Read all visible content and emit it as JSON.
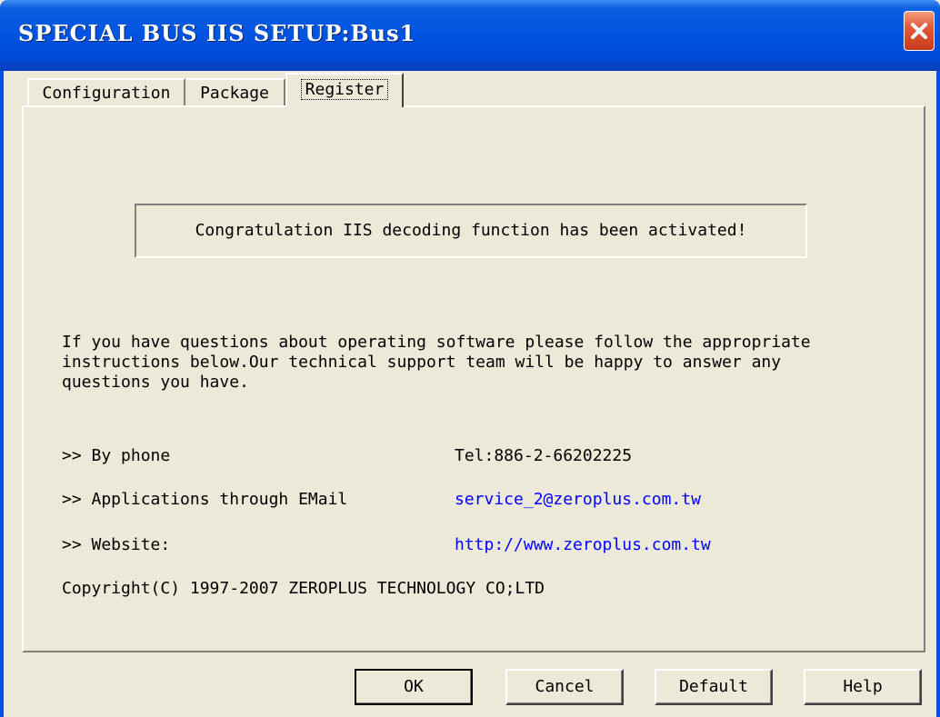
{
  "window": {
    "title": "SPECIAL BUS IIS SETUP:Bus1"
  },
  "tabs": {
    "configuration": "Configuration",
    "package": "Package",
    "register": "Register"
  },
  "register": {
    "notice": "Congratulation IIS decoding function has been activated!",
    "info": "If you have questions about operating software please follow the appropriate\ninstructions below.Our technical support team will be happy to answer any\nquestions you have.",
    "phone_label": ">> By phone",
    "phone_value": "Tel:886-2-66202225",
    "email_label": ">> Applications through EMail",
    "email_value": "service_2@zeroplus.com.tw",
    "website_label": ">> Website:",
    "website_value": "http://www.zeroplus.com.tw",
    "copyright": "Copyright(C) 1997-2007 ZEROPLUS TECHNOLOGY CO;LTD"
  },
  "buttons": {
    "ok": "OK",
    "cancel": "Cancel",
    "default": "Default",
    "help": "Help"
  },
  "colors": {
    "titlebar": "#0053e0",
    "link": "#0000ff",
    "face": "#ece9d8",
    "close": "#e2593a"
  },
  "icons": {
    "close": "close-icon"
  }
}
